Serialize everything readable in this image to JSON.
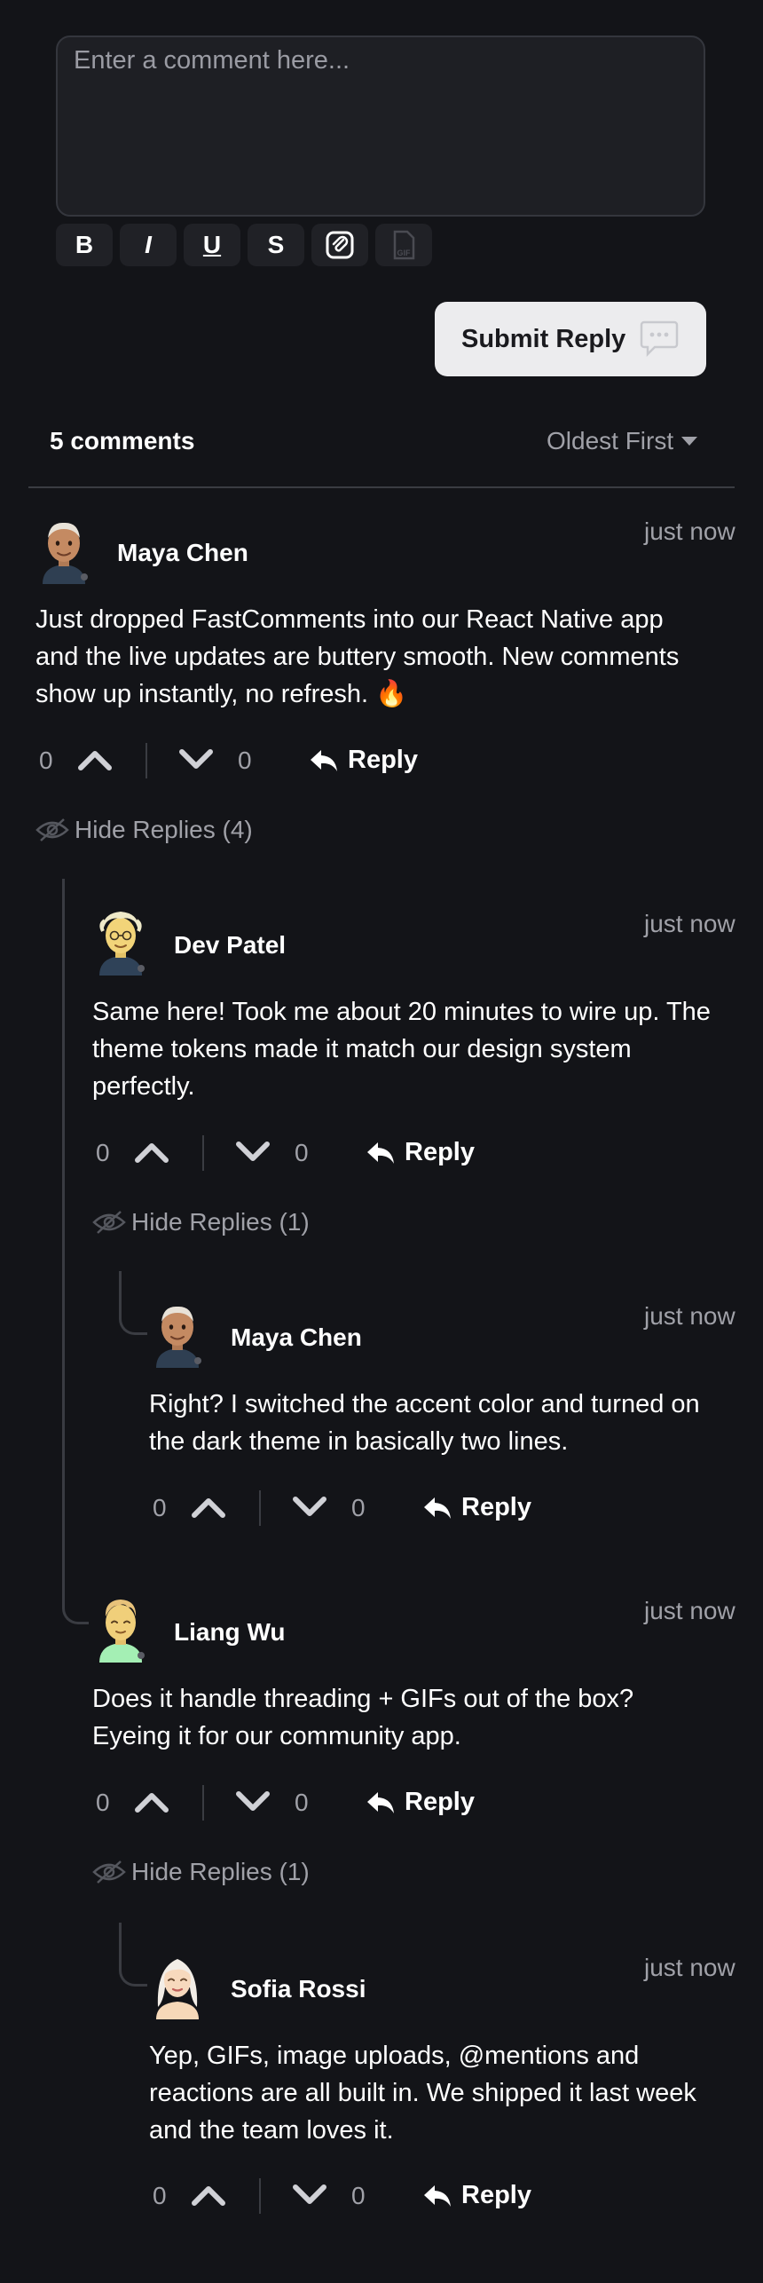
{
  "editor": {
    "placeholder": "Enter a comment here...",
    "toolbar": {
      "bold": "B",
      "italic": "I",
      "underline": "U",
      "strike": "S",
      "gif": "GIF"
    }
  },
  "submit_label": "Submit Reply",
  "list": {
    "count_label": "5 comments",
    "sort_label": "Oldest First"
  },
  "hide_replies": {
    "c1": "Hide Replies (4)",
    "c2": "Hide Replies (1)",
    "c4": "Hide Replies (1)"
  },
  "reply_label": "Reply",
  "comments": [
    {
      "author": "Maya Chen",
      "time": "just now",
      "lines": [
        "Just dropped FastComments into our React Native app",
        "and the live updates are buttery smooth. New comments",
        "show up instantly, no refresh. 🔥"
      ],
      "up": "0",
      "down": "0"
    },
    {
      "author": "Dev Patel",
      "time": "just now",
      "lines": [
        "Same here! Took me about 20 minutes to wire up. The",
        "theme tokens made it match our design system",
        "perfectly."
      ],
      "up": "0",
      "down": "0"
    },
    {
      "author": "Maya Chen",
      "time": "just now",
      "lines": [
        "Right? I switched the accent color and turned on",
        "the dark theme in basically two lines."
      ],
      "up": "0",
      "down": "0"
    },
    {
      "author": "Liang Wu",
      "time": "just now",
      "lines": [
        "Does it handle threading + GIFs out of the box?",
        "Eyeing it for our community app."
      ],
      "up": "0",
      "down": "0"
    },
    {
      "author": "Sofia Rossi",
      "time": "just now",
      "lines": [
        "Yep, GIFs, image uploads, @mentions and",
        "reactions are all built in. We shipped it last week",
        "and the team loves it."
      ],
      "up": "0",
      "down": "0"
    }
  ]
}
